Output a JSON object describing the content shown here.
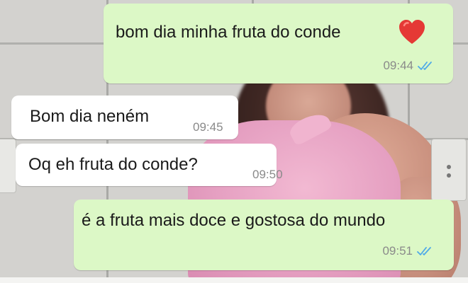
{
  "conversation": {
    "messages": [
      {
        "direction": "outgoing",
        "text": "bom dia minha fruta do conde",
        "emoji": "red-heart",
        "time": "09:44",
        "status": "read"
      },
      {
        "direction": "incoming",
        "text": "Bom dia neném",
        "time": "09:45"
      },
      {
        "direction": "incoming",
        "text": "Oq eh fruta do conde?",
        "time": "09:50"
      },
      {
        "direction": "outgoing",
        "text": "é  a fruta mais doce e gostosa do mundo",
        "time": "09:51",
        "status": "read"
      }
    ]
  },
  "colors": {
    "outgoing_bubble": "#dcf8c6",
    "incoming_bubble": "#ffffff",
    "read_ticks": "#4fa9e8",
    "timestamp": "#8a8a8a",
    "heart": "#e53935"
  }
}
